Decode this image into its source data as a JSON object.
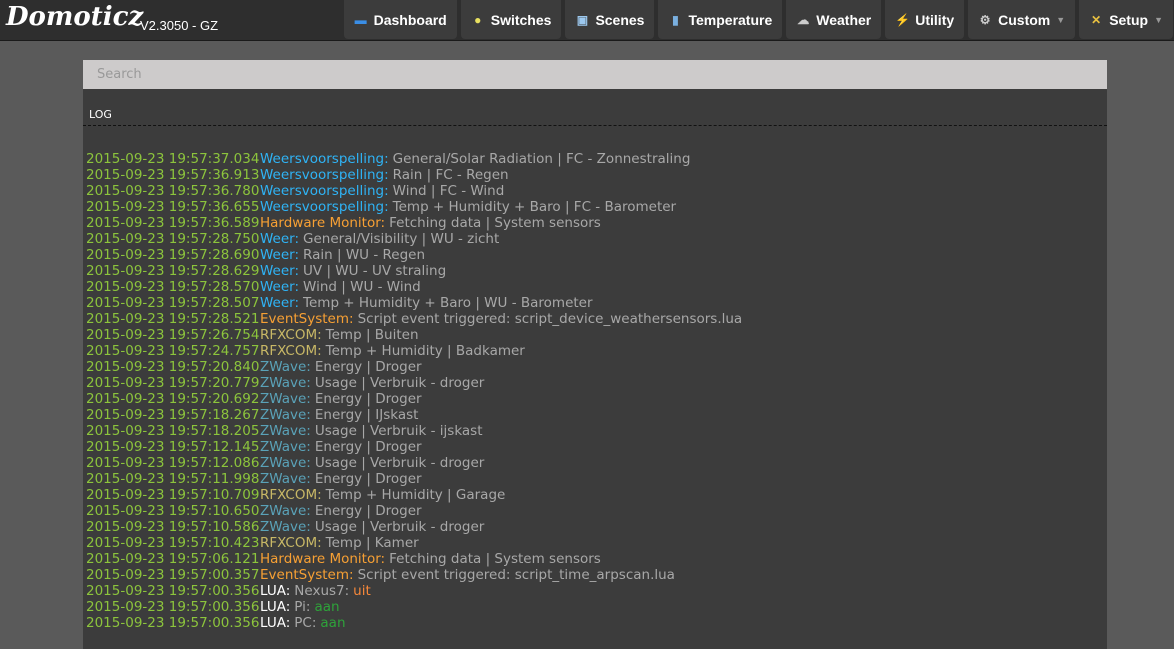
{
  "header": {
    "logo": "Domoticz",
    "version": "V2.3050 - GZ"
  },
  "nav": [
    {
      "label": "Dashboard",
      "icon": "dashboard-icon",
      "glyph": "▬",
      "color": "#3a8ee6"
    },
    {
      "label": "Switches",
      "icon": "lightbulb-icon",
      "glyph": "●",
      "color": "#e8e060"
    },
    {
      "label": "Scenes",
      "icon": "scenes-icon",
      "glyph": "▣",
      "color": "#9cc8ee"
    },
    {
      "label": "Temperature",
      "icon": "thermometer-icon",
      "glyph": "▮",
      "color": "#7ab0e0"
    },
    {
      "label": "Weather",
      "icon": "weather-icon",
      "glyph": "☁",
      "color": "#ccc"
    },
    {
      "label": "Utility",
      "icon": "utility-icon",
      "glyph": "⚡",
      "color": "#f0e020"
    },
    {
      "label": "Custom",
      "icon": "custom-gear-icon",
      "glyph": "⚙",
      "color": "#ccc",
      "dropdown": true
    },
    {
      "label": "Setup",
      "icon": "setup-tools-icon",
      "glyph": "✕",
      "color": "#e8c040",
      "dropdown": true
    }
  ],
  "search": {
    "placeholder": "Search",
    "value": ""
  },
  "log": {
    "title": "LOG",
    "colors": {
      "weather": "#2fb3f5",
      "system": "#f7a034",
      "rfxcom": "#c8b866",
      "zwave": "#5aa2b8",
      "lua": "#ffffff",
      "timestamp": "#8cc43c",
      "message": "#a8a8a8"
    },
    "entries": [
      {
        "ts": "2015-09-23 19:57:37.034",
        "src": "Weersvoorspelling:",
        "type": "weather",
        "msg": "General/Solar Radiation | FC - Zonnestraling"
      },
      {
        "ts": "2015-09-23 19:57:36.913",
        "src": "Weersvoorspelling:",
        "type": "weather",
        "msg": "Rain | FC - Regen"
      },
      {
        "ts": "2015-09-23 19:57:36.780",
        "src": "Weersvoorspelling:",
        "type": "weather",
        "msg": "Wind | FC - Wind"
      },
      {
        "ts": "2015-09-23 19:57:36.655",
        "src": "Weersvoorspelling:",
        "type": "weather",
        "msg": "Temp + Humidity + Baro | FC - Barometer"
      },
      {
        "ts": "2015-09-23 19:57:36.589",
        "src": "Hardware Monitor:",
        "type": "system",
        "msg": "Fetching data | System sensors"
      },
      {
        "ts": "2015-09-23 19:57:28.750",
        "src": "Weer:",
        "type": "weather",
        "msg": "General/Visibility | WU - zicht"
      },
      {
        "ts": "2015-09-23 19:57:28.690",
        "src": "Weer:",
        "type": "weather",
        "msg": "Rain | WU - Regen"
      },
      {
        "ts": "2015-09-23 19:57:28.629",
        "src": "Weer:",
        "type": "weather",
        "msg": "UV | WU - UV straling"
      },
      {
        "ts": "2015-09-23 19:57:28.570",
        "src": "Weer:",
        "type": "weather",
        "msg": "Wind | WU - Wind"
      },
      {
        "ts": "2015-09-23 19:57:28.507",
        "src": "Weer:",
        "type": "weather",
        "msg": "Temp + Humidity + Baro | WU - Barometer"
      },
      {
        "ts": "2015-09-23 19:57:28.521",
        "src": "EventSystem:",
        "type": "system",
        "msg": "Script event triggered: script_device_weathersensors.lua"
      },
      {
        "ts": "2015-09-23 19:57:26.754",
        "src": "RFXCOM:",
        "type": "rfxcom",
        "msg": "Temp | Buiten"
      },
      {
        "ts": "2015-09-23 19:57:24.757",
        "src": "RFXCOM:",
        "type": "rfxcom",
        "msg": "Temp + Humidity | Badkamer"
      },
      {
        "ts": "2015-09-23 19:57:20.840",
        "src": "ZWave:",
        "type": "zwave",
        "msg": "Energy | Droger"
      },
      {
        "ts": "2015-09-23 19:57:20.779",
        "src": "ZWave:",
        "type": "zwave",
        "msg": "Usage | Verbruik - droger"
      },
      {
        "ts": "2015-09-23 19:57:20.692",
        "src": "ZWave:",
        "type": "zwave",
        "msg": "Energy | Droger"
      },
      {
        "ts": "2015-09-23 19:57:18.267",
        "src": "ZWave:",
        "type": "zwave",
        "msg": "Energy | IJskast"
      },
      {
        "ts": "2015-09-23 19:57:18.205",
        "src": "ZWave:",
        "type": "zwave",
        "msg": "Usage | Verbruik - ijskast"
      },
      {
        "ts": "2015-09-23 19:57:12.145",
        "src": "ZWave:",
        "type": "zwave",
        "msg": "Energy | Droger"
      },
      {
        "ts": "2015-09-23 19:57:12.086",
        "src": "ZWave:",
        "type": "zwave",
        "msg": "Usage | Verbruik - droger"
      },
      {
        "ts": "2015-09-23 19:57:11.998",
        "src": "ZWave:",
        "type": "zwave",
        "msg": "Energy | Droger"
      },
      {
        "ts": "2015-09-23 19:57:10.709",
        "src": "RFXCOM:",
        "type": "rfxcom",
        "msg": "Temp + Humidity | Garage"
      },
      {
        "ts": "2015-09-23 19:57:10.650",
        "src": "ZWave:",
        "type": "zwave",
        "msg": "Energy | Droger"
      },
      {
        "ts": "2015-09-23 19:57:10.586",
        "src": "ZWave:",
        "type": "zwave",
        "msg": "Usage | Verbruik - droger"
      },
      {
        "ts": "2015-09-23 19:57:10.423",
        "src": "RFXCOM:",
        "type": "rfxcom",
        "msg": "Temp | Kamer"
      },
      {
        "ts": "2015-09-23 19:57:06.121",
        "src": "Hardware Monitor:",
        "type": "system",
        "msg": "Fetching data | System sensors"
      },
      {
        "ts": "2015-09-23 19:57:00.357",
        "src": "EventSystem:",
        "type": "system",
        "msg": "Script event triggered: script_time_arpscan.lua"
      },
      {
        "ts": "2015-09-23 19:57:00.356",
        "src": "LUA:",
        "type": "lua",
        "msg": "Nexus7:",
        "value": "uit",
        "state": "off"
      },
      {
        "ts": "2015-09-23 19:57:00.356",
        "src": "LUA:",
        "type": "lua",
        "msg": "Pi:",
        "value": "aan",
        "state": "on"
      },
      {
        "ts": "2015-09-23 19:57:00.356",
        "src": "LUA:",
        "type": "lua",
        "msg": "PC:",
        "value": "aan",
        "state": "on"
      }
    ]
  }
}
